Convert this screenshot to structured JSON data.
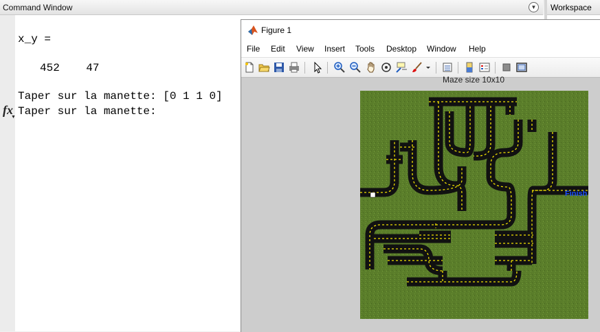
{
  "command_window": {
    "title": "Command Window",
    "lines": [
      "x_y =",
      "452    47",
      "Taper sur la manette: [0 1 1 0]",
      "Taper sur la manette:"
    ],
    "prompt_symbol": "fx"
  },
  "workspace": {
    "title": "Workspace"
  },
  "figure": {
    "title": "Figure 1",
    "menu": [
      "File",
      "Edit",
      "View",
      "Insert",
      "Tools",
      "Desktop",
      "Window",
      "Help"
    ],
    "toolbar_icons": [
      "new-figure-icon",
      "open-file-icon",
      "save-icon",
      "print-icon",
      "select-arrow-icon",
      "zoom-in-icon",
      "zoom-out-icon",
      "pan-icon",
      "rotate-3d-icon",
      "data-cursor-icon",
      "brush-icon",
      "brush-dropdown-icon",
      "link-plot-icon",
      "insert-colorbar-icon",
      "insert-legend-icon",
      "hide-plot-tools-icon",
      "show-plot-tools-icon"
    ],
    "axes_title": "Maze size 10x10",
    "finish_label": "Finish",
    "colors": {
      "grass": "#5a7d2a",
      "road": "#111111",
      "lane": "#f2e200",
      "finish": "#1a4fff",
      "marker": "#ffffff"
    }
  }
}
